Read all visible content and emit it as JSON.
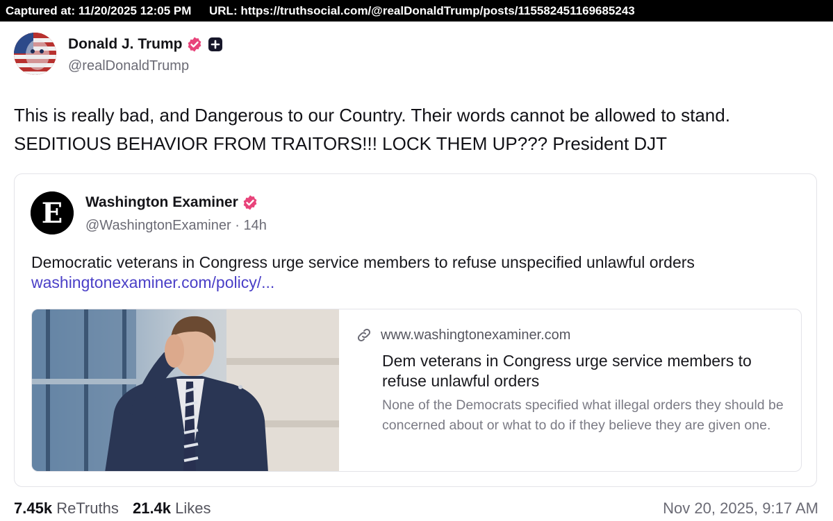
{
  "capture": {
    "captured_label": "Captured at: 11/20/2025 12:05 PM",
    "url_label": "URL: https://truthsocial.com/@realDonaldTrump/posts/115582451169685243"
  },
  "author": {
    "name": "Donald J. Trump",
    "handle": "@realDonaldTrump",
    "verified_icon": "verified-badge-icon",
    "plus_icon": "plus-badge-icon"
  },
  "post": {
    "text_line1": "This is really bad, and Dangerous to our Country. Their words cannot be allowed to stand.",
    "text_line2": "SEDITIOUS BEHAVIOR FROM TRAITORS!!! LOCK THEM UP??? President DJT"
  },
  "quote": {
    "name": "Washington Examiner",
    "handle": "@WashingtonExaminer",
    "separator": "·",
    "age": "14h",
    "text": "Democratic veterans in Congress urge service members to refuse unspecified unlawful orders",
    "link_text": "washingtonexaminer.com/policy/...",
    "avatar_letter": "E"
  },
  "link_preview": {
    "domain": "www.washingtonexaminer.com",
    "title": "Dem veterans in Congress urge service members to refuse unlawful orders",
    "description": "None of the Democrats specified what illegal orders they should be concerned about or what to do if they believe they are given one."
  },
  "stats": {
    "retruths_count": "7.45k",
    "retruths_label": "ReTruths",
    "likes_count": "21.4k",
    "likes_label": "Likes",
    "timestamp": "Nov 20, 2025, 9:17 AM"
  },
  "colors": {
    "verified": "#e8437a",
    "link": "#4a3fc7",
    "muted": "#6b6b75"
  }
}
